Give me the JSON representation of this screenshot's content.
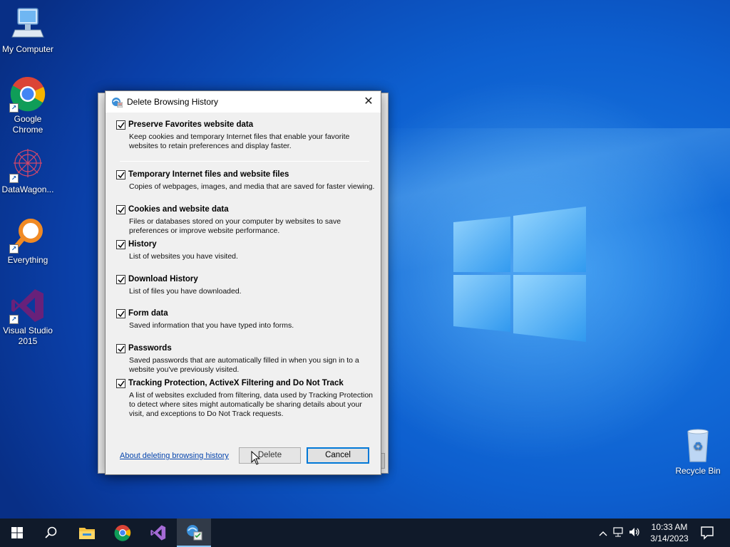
{
  "desktop": {
    "icons": [
      {
        "label": "My Computer",
        "icon": "computer-icon"
      },
      {
        "label": "Google Chrome",
        "icon": "chrome-icon"
      },
      {
        "label": "DataWagon...",
        "icon": "datawagon-icon"
      },
      {
        "label": "Everything",
        "icon": "everything-search-icon"
      },
      {
        "label": "Visual Studio 2015",
        "icon": "visual-studio-icon"
      },
      {
        "label": "Recycle Bin",
        "icon": "recycle-bin-icon"
      }
    ]
  },
  "dialog": {
    "title": "Delete Browsing History",
    "close_glyph": "✕",
    "options": [
      {
        "label": "Preserve Favorites website data",
        "checked": true,
        "description": "Keep cookies and temporary Internet files that enable your favorite websites to retain preferences and display faster."
      },
      {
        "label": "Temporary Internet files and website files",
        "checked": true,
        "description": "Copies of webpages, images, and media that are saved for faster viewing."
      },
      {
        "label": "Cookies and website data",
        "checked": true,
        "description": "Files or databases stored on your computer by websites to save preferences or improve website performance."
      },
      {
        "label": "History",
        "checked": true,
        "description": "List of websites you have visited."
      },
      {
        "label": "Download History",
        "checked": true,
        "description": "List of files you have downloaded."
      },
      {
        "label": "Form data",
        "checked": true,
        "description": "Saved information that you have typed into forms."
      },
      {
        "label": "Passwords",
        "checked": true,
        "description": "Saved passwords that are automatically filled in when you sign in to a website you've previously visited."
      },
      {
        "label": "Tracking Protection, ActiveX Filtering and Do Not Track",
        "checked": true,
        "description": "A list of websites excluded from filtering, data used by Tracking Protection to detect where sites might automatically be sharing details about your visit, and exceptions to Do Not Track requests."
      }
    ],
    "about_link": "About deleting browsing history",
    "delete_label": "Delete",
    "cancel_label": "Cancel"
  },
  "taskbar": {
    "items": [
      "start-icon",
      "search-icon",
      "file-explorer-icon",
      "chrome-icon",
      "visual-studio-icon",
      "internet-options-icon"
    ],
    "time": "10:33 AM",
    "date": "3/14/2023"
  },
  "colors": {
    "accent": "#0078d7",
    "link": "#0645ad",
    "taskbar": "#101a2a"
  }
}
